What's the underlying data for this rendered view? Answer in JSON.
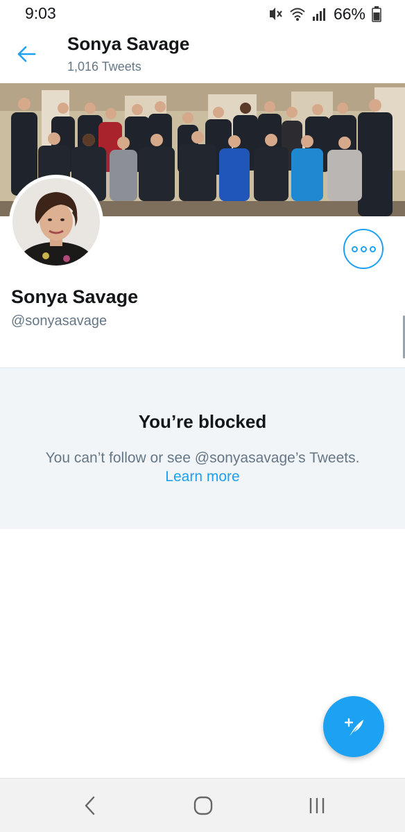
{
  "status_bar": {
    "time": "9:03",
    "battery_percent": "66%",
    "icons": [
      "mute-vibrate-icon",
      "wifi-icon",
      "signal-icon",
      "battery-icon"
    ]
  },
  "header": {
    "title": "Sonya Savage",
    "subtitle": "1,016 Tweets",
    "back_icon": "back-arrow-icon"
  },
  "profile": {
    "name": "Sonya Savage",
    "handle": "@sonyasavage",
    "more_icon": "more-options-icon"
  },
  "blocked": {
    "title": "You’re blocked",
    "description": "You can’t follow or see @sonyasavage’s Tweets.",
    "link": "Learn more"
  },
  "fab": {
    "icon": "compose-tweet-icon"
  },
  "nav_bar": {
    "buttons": [
      "back-nav-icon",
      "home-nav-icon",
      "recents-nav-icon"
    ]
  },
  "colors": {
    "accent": "#1da1f2",
    "text_primary": "#14171a",
    "text_secondary": "#657786",
    "panel_bg": "#f1f5f8"
  }
}
